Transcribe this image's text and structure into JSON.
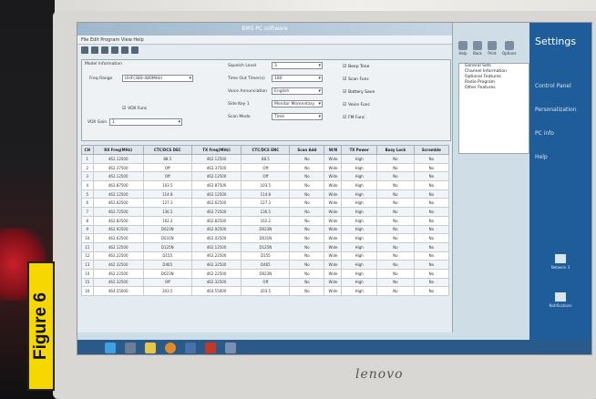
{
  "figure_label": "Figure 6",
  "brand": "lenovo",
  "window_title": "BMS PC software",
  "menu": "File  Edit  Program  View  Help",
  "settings": {
    "title": "Model Information",
    "freq_range_label": "Freq Range",
    "freq_range_value": "UHF(380-480MHz)",
    "vox_label": "VOX Func",
    "vox_gain_label": "VOX Gain",
    "vox_gain_value": "1",
    "squelch_label": "Squelch Level",
    "squelch_value": "3",
    "tot_label": "Time Out Timer(s)",
    "tot_value": "180",
    "voice_label": "Voice Annunciation",
    "voice_value": "English",
    "sidekey_label": "Side Key 1",
    "sidekey_value": "Monitor Momentary",
    "scan_label": "Scan Mode",
    "scan_value": "Time",
    "checks": [
      "Beep Tone",
      "Scan Func",
      "Battery Save",
      "Voice Func",
      "FM Func"
    ]
  },
  "table": {
    "headers": [
      "CH",
      "RX Freq(MHz)",
      "CTC/DCS DEC",
      "TX Freq(MHz)",
      "CTC/DCS ENC",
      "Scan Add",
      "W/N",
      "TX Power",
      "Busy Lock",
      "Scramble"
    ],
    "rows": [
      [
        "1",
        "462.12500",
        "88.5",
        "462.12500",
        "88.5",
        "No",
        "Wide",
        "High",
        "No",
        "No"
      ],
      [
        "2",
        "462.37500",
        "Off",
        "462.37500",
        "Off",
        "No",
        "Wide",
        "High",
        "No",
        "No"
      ],
      [
        "3",
        "462.12500",
        "Off",
        "462.12500",
        "Off",
        "No",
        "Wide",
        "High",
        "No",
        "No"
      ],
      [
        "4",
        "462.87500",
        "103.5",
        "462.87500",
        "103.5",
        "No",
        "Wide",
        "High",
        "No",
        "No"
      ],
      [
        "5",
        "462.12500",
        "114.8",
        "462.12500",
        "114.8",
        "No",
        "Wide",
        "High",
        "No",
        "No"
      ],
      [
        "6",
        "462.62500",
        "127.3",
        "462.62500",
        "127.3",
        "No",
        "Wide",
        "High",
        "No",
        "No"
      ],
      [
        "7",
        "462.72500",
        "136.5",
        "462.72500",
        "136.5",
        "No",
        "Wide",
        "High",
        "No",
        "No"
      ],
      [
        "8",
        "462.82500",
        "162.2",
        "462.82500",
        "162.2",
        "No",
        "Wide",
        "High",
        "No",
        "No"
      ],
      [
        "9",
        "462.92500",
        "D023N",
        "462.92500",
        "D023N",
        "No",
        "Wide",
        "High",
        "No",
        "No"
      ],
      [
        "10",
        "462.02500",
        "D031N",
        "462.02500",
        "D031N",
        "No",
        "Wide",
        "High",
        "No",
        "No"
      ],
      [
        "11",
        "462.12500",
        "D125N",
        "462.12500",
        "D125N",
        "No",
        "Wide",
        "High",
        "No",
        "No"
      ],
      [
        "12",
        "462.22500",
        "D155",
        "462.22500",
        "D155",
        "No",
        "Wide",
        "High",
        "No",
        "No"
      ],
      [
        "13",
        "462.32500",
        "D465",
        "462.32500",
        "D465",
        "No",
        "Wide",
        "High",
        "No",
        "No"
      ],
      [
        "14",
        "462.22500",
        "D023N",
        "462.22500",
        "D023N",
        "No",
        "Wide",
        "High",
        "No",
        "No"
      ],
      [
        "15",
        "462.32500",
        "Off",
        "462.32500",
        "Off",
        "No",
        "Wide",
        "High",
        "No",
        "No"
      ],
      [
        "16",
        "464.55000",
        "203.5",
        "464.55000",
        "203.5",
        "No",
        "Wide",
        "High",
        "No",
        "No"
      ]
    ]
  },
  "tree": [
    "General Sets",
    "Channel Information",
    "Optional Features",
    "Radio Program",
    "Other Features"
  ],
  "top_icons": [
    "Help",
    "Back",
    "Print",
    "Options"
  ],
  "charms": {
    "title": "Settings",
    "items": [
      "Control Panel",
      "Personalization",
      "PC info",
      "Help"
    ],
    "bottom": [
      "Network 3",
      "Notifications"
    ]
  }
}
